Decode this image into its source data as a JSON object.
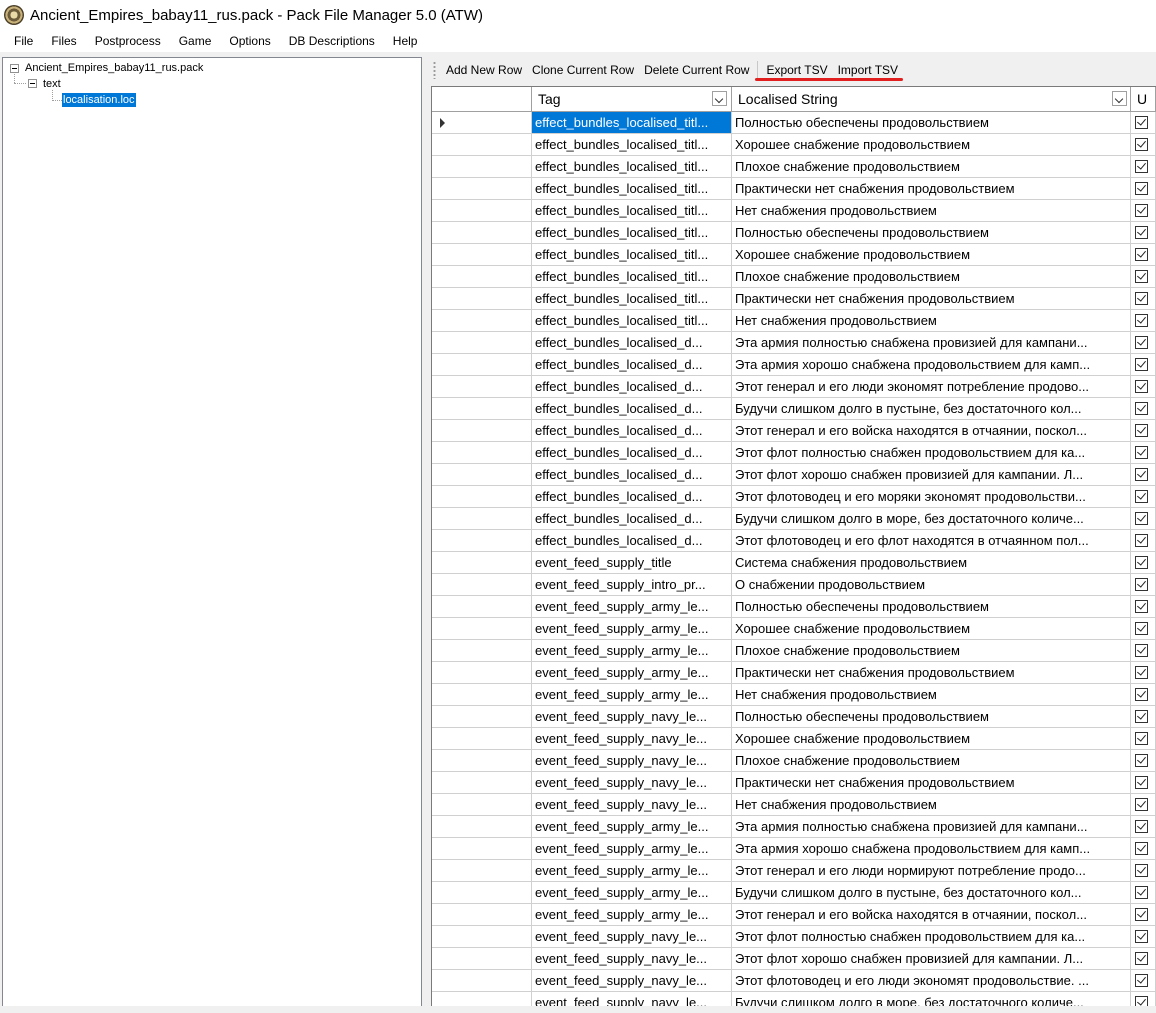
{
  "window": {
    "title": "Ancient_Empires_babay11_rus.pack - Pack File Manager 5.0 (ATW)",
    "icon": "pack-manager-app-icon"
  },
  "menu": [
    "File",
    "Files",
    "Postprocess",
    "Game",
    "Options",
    "DB Descriptions",
    "Help"
  ],
  "tree": {
    "root": "Ancient_Empires_babay11_rus.pack",
    "folder": "text",
    "file": "localisation.loc"
  },
  "toolbar": {
    "add_row": "Add New Row",
    "clone_row": "Clone Current Row",
    "delete_row": "Delete Current Row",
    "export_tsv": "Export TSV",
    "import_tsv": "Import TSV"
  },
  "colors": {
    "selection": "#0078d7",
    "annotation_underline": "#e21f1f"
  },
  "table": {
    "columns": [
      "Tag",
      "Localised String",
      "U"
    ],
    "rows": [
      {
        "tag": "effect_bundles_localised_titl...",
        "text": "Полностью обеспечены продовольствием",
        "u": true
      },
      {
        "tag": "effect_bundles_localised_titl...",
        "text": "Хорошее снабжение продовольствием",
        "u": true
      },
      {
        "tag": "effect_bundles_localised_titl...",
        "text": "Плохое снабжение продовольствием",
        "u": true
      },
      {
        "tag": "effect_bundles_localised_titl...",
        "text": "Практически нет снабжения продовольствием",
        "u": true
      },
      {
        "tag": "effect_bundles_localised_titl...",
        "text": "Нет снабжения продовольствием",
        "u": true
      },
      {
        "tag": "effect_bundles_localised_titl...",
        "text": "Полностью обеспечены продовольствием",
        "u": true
      },
      {
        "tag": "effect_bundles_localised_titl...",
        "text": "Хорошее снабжение продовольствием",
        "u": true
      },
      {
        "tag": "effect_bundles_localised_titl...",
        "text": "Плохое снабжение продовольствием",
        "u": true
      },
      {
        "tag": "effect_bundles_localised_titl...",
        "text": "Практически нет снабжения продовольствием",
        "u": true
      },
      {
        "tag": "effect_bundles_localised_titl...",
        "text": "Нет снабжения продовольствием",
        "u": true
      },
      {
        "tag": "effect_bundles_localised_d...",
        "text": "Эта армия полностью снабжена провизией для кампани...",
        "u": true
      },
      {
        "tag": "effect_bundles_localised_d...",
        "text": "Эта армия хорошо снабжена продовольствием для камп...",
        "u": true
      },
      {
        "tag": "effect_bundles_localised_d...",
        "text": "Этот генерал и его люди экономят потребление продово...",
        "u": true
      },
      {
        "tag": "effect_bundles_localised_d...",
        "text": "Будучи слишком долго в пустыне, без достаточного кол...",
        "u": true
      },
      {
        "tag": "effect_bundles_localised_d...",
        "text": "Этот генерал и его войска находятся в отчаянии, поскол...",
        "u": true
      },
      {
        "tag": "effect_bundles_localised_d...",
        "text": "Этот флот полностью снабжен продовольствием для ка...",
        "u": true
      },
      {
        "tag": "effect_bundles_localised_d...",
        "text": "Этот флот хорошо снабжен провизией для кампании. Л...",
        "u": true
      },
      {
        "tag": "effect_bundles_localised_d...",
        "text": "Этот флотоводец и его моряки экономят продовольстви...",
        "u": true
      },
      {
        "tag": "effect_bundles_localised_d...",
        "text": "Будучи слишком долго в море, без достаточного количе...",
        "u": true
      },
      {
        "tag": "effect_bundles_localised_d...",
        "text": "Этот флотоводец и его флот находятся в отчаянном пол...",
        "u": true
      },
      {
        "tag": "event_feed_supply_title",
        "text": "Система снабжения продовольствием",
        "u": true
      },
      {
        "tag": "event_feed_supply_intro_pr...",
        "text": "О снабжении продовольствием",
        "u": true
      },
      {
        "tag": "event_feed_supply_army_le...",
        "text": "Полностью обеспечены продовольствием",
        "u": true
      },
      {
        "tag": "event_feed_supply_army_le...",
        "text": "Хорошее снабжение продовольствием",
        "u": true
      },
      {
        "tag": "event_feed_supply_army_le...",
        "text": "Плохое снабжение продовольствием",
        "u": true
      },
      {
        "tag": "event_feed_supply_army_le...",
        "text": "Практически нет снабжения продовольствием",
        "u": true
      },
      {
        "tag": "event_feed_supply_army_le...",
        "text": "Нет снабжения продовольствием",
        "u": true
      },
      {
        "tag": "event_feed_supply_navy_le...",
        "text": "Полностью обеспечены продовольствием",
        "u": true
      },
      {
        "tag": "event_feed_supply_navy_le...",
        "text": "Хорошее снабжение продовольствием",
        "u": true
      },
      {
        "tag": "event_feed_supply_navy_le...",
        "text": "Плохое снабжение продовольствием",
        "u": true
      },
      {
        "tag": "event_feed_supply_navy_le...",
        "text": "Практически нет снабжения продовольствием",
        "u": true
      },
      {
        "tag": "event_feed_supply_navy_le...",
        "text": "Нет снабжения продовольствием",
        "u": true
      },
      {
        "tag": "event_feed_supply_army_le...",
        "text": "Эта армия полностью снабжена провизией для кампани...",
        "u": true
      },
      {
        "tag": "event_feed_supply_army_le...",
        "text": "Эта армия хорошо снабжена продовольствием для камп...",
        "u": true
      },
      {
        "tag": "event_feed_supply_army_le...",
        "text": "Этот генерал и его люди нормируют потребление продо...",
        "u": true
      },
      {
        "tag": "event_feed_supply_army_le...",
        "text": "Будучи слишком долго в пустыне, без достаточного кол...",
        "u": true
      },
      {
        "tag": "event_feed_supply_army_le...",
        "text": "Этот генерал и его войска находятся в отчаянии, поскол...",
        "u": true
      },
      {
        "tag": "event_feed_supply_navy_le...",
        "text": "Этот флот полностью снабжен продовольствием для ка...",
        "u": true
      },
      {
        "tag": "event_feed_supply_navy_le...",
        "text": "Этот флот хорошо снабжен провизией для кампании. Л...",
        "u": true
      },
      {
        "tag": "event_feed_supply_navy_le...",
        "text": "Этот флотоводец и его люди экономят продовольствие. ...",
        "u": true
      },
      {
        "tag": "event_feed_supply_navy_le...",
        "text": "Будучи слишком долго в море, без достаточного количе...",
        "u": true
      }
    ]
  }
}
